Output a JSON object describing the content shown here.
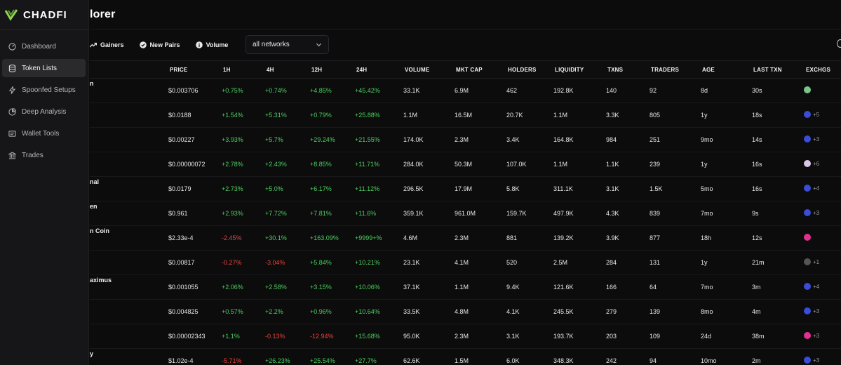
{
  "app": {
    "logo_text": "CHADFI",
    "page_title": "lorer",
    "brand_color": "#8fd14f"
  },
  "sidebar": {
    "items": [
      {
        "label": "Dashboard",
        "icon": "dashboard-icon",
        "active": false
      },
      {
        "label": "Token Lists",
        "icon": "database-icon",
        "active": true
      },
      {
        "label": "Spoonfed Setups",
        "icon": "bolt-icon",
        "active": false
      },
      {
        "label": "Deep Analysis",
        "icon": "pie-chart-icon",
        "active": false
      },
      {
        "label": "Wallet Tools",
        "icon": "wallet-icon",
        "active": false
      },
      {
        "label": "Trades",
        "icon": "bank-icon",
        "active": false
      }
    ]
  },
  "filters": {
    "gainers": "Gainers",
    "new_pairs": "New Pairs",
    "volume": "Volume",
    "network_select": "all networks"
  },
  "table": {
    "columns": [
      "PRICE",
      "1H",
      "4H",
      "12H",
      "24H",
      "VOLUME",
      "MKT CAP",
      "HOLDERS",
      "LIQUIDITY",
      "TXNS",
      "TRADERS",
      "AGE",
      "LAST TXN",
      "EXCHGS"
    ],
    "rows": [
      {
        "name": "n",
        "price": "$0.003706",
        "h1": "+0.75%",
        "h4": "+0.74%",
        "h12": "+4.85%",
        "h24": "+45.42%",
        "volume": "33.1K",
        "mktcap": "6.9M",
        "holders": "462",
        "liquidity": "192.8K",
        "txns": "140",
        "traders": "92",
        "age": "8d",
        "last": "30s",
        "exch_color": "#7cc48a",
        "exch_count": ""
      },
      {
        "name": "",
        "price": "$0.0188",
        "h1": "+1.54%",
        "h4": "+5.31%",
        "h12": "+0.79%",
        "h24": "+25.88%",
        "volume": "1.1M",
        "mktcap": "16.5M",
        "holders": "20.7K",
        "liquidity": "1.1M",
        "txns": "3.3K",
        "traders": "805",
        "age": "1y",
        "last": "18s",
        "exch_color": "#3a4cd8",
        "exch_count": "+5"
      },
      {
        "name": "",
        "price": "$0.00227",
        "h1": "+3.93%",
        "h4": "+5.7%",
        "h12": "+29.24%",
        "h24": "+21.55%",
        "volume": "174.0K",
        "mktcap": "2.3M",
        "holders": "3.4K",
        "liquidity": "164.8K",
        "txns": "984",
        "traders": "251",
        "age": "9mo",
        "last": "14s",
        "exch_color": "#3a4cd8",
        "exch_count": "+3"
      },
      {
        "name": "",
        "price": "$0.00000072",
        "h1": "+2.78%",
        "h4": "+2.43%",
        "h12": "+8.85%",
        "h24": "+11.71%",
        "volume": "284.0K",
        "mktcap": "50.3M",
        "holders": "107.0K",
        "liquidity": "1.1M",
        "txns": "1.1K",
        "traders": "239",
        "age": "1y",
        "last": "16s",
        "exch_color": "#d9c7e8",
        "exch_count": "+6"
      },
      {
        "name": "nal",
        "price": "$0.0179",
        "h1": "+2.73%",
        "h4": "+5.0%",
        "h12": "+6.17%",
        "h24": "+11.12%",
        "volume": "296.5K",
        "mktcap": "17.9M",
        "holders": "5.8K",
        "liquidity": "311.1K",
        "txns": "3.1K",
        "traders": "1.5K",
        "age": "5mo",
        "last": "16s",
        "exch_color": "#3a4cd8",
        "exch_count": "+4"
      },
      {
        "name": "en",
        "price": "$0.961",
        "h1": "+2.93%",
        "h4": "+7.72%",
        "h12": "+7.81%",
        "h24": "+11.6%",
        "volume": "359.1K",
        "mktcap": "961.0M",
        "holders": "159.7K",
        "liquidity": "497.9K",
        "txns": "4.3K",
        "traders": "839",
        "age": "7mo",
        "last": "9s",
        "exch_color": "#3a4cd8",
        "exch_count": "+3"
      },
      {
        "name": "n Coin",
        "price": "$2.33e-4",
        "h1": "-2.45%",
        "h4": "+30.1%",
        "h12": "+163.09%",
        "h24": "+9999+%",
        "volume": "4.6M",
        "mktcap": "2.3M",
        "holders": "881",
        "liquidity": "139.2K",
        "txns": "3.9K",
        "traders": "877",
        "age": "18h",
        "last": "12s",
        "exch_color": "#e0328c",
        "exch_count": ""
      },
      {
        "name": "",
        "price": "$0.00817",
        "h1": "-0.27%",
        "h4": "-3.04%",
        "h12": "+5.84%",
        "h24": "+10.21%",
        "volume": "23.1K",
        "mktcap": "4.1M",
        "holders": "520",
        "liquidity": "2.5M",
        "txns": "284",
        "traders": "131",
        "age": "1y",
        "last": "21m",
        "exch_color": "#555555",
        "exch_count": "+1"
      },
      {
        "name": "aximus",
        "price": "$0.001055",
        "h1": "+2.06%",
        "h4": "+2.58%",
        "h12": "+3.15%",
        "h24": "+10.06%",
        "volume": "37.1K",
        "mktcap": "1.1M",
        "holders": "9.4K",
        "liquidity": "121.6K",
        "txns": "166",
        "traders": "64",
        "age": "7mo",
        "last": "3m",
        "exch_color": "#3a4cd8",
        "exch_count": "+4"
      },
      {
        "name": "",
        "price": "$0.004825",
        "h1": "+0.57%",
        "h4": "+2.2%",
        "h12": "+0.96%",
        "h24": "+10.64%",
        "volume": "33.5K",
        "mktcap": "4.8M",
        "holders": "4.1K",
        "liquidity": "245.5K",
        "txns": "279",
        "traders": "139",
        "age": "8mo",
        "last": "4m",
        "exch_color": "#3a4cd8",
        "exch_count": "+3"
      },
      {
        "name": "",
        "price": "$0.00002343",
        "h1": "+1.1%",
        "h4": "-0.13%",
        "h12": "-12.94%",
        "h24": "+15.68%",
        "volume": "95.0K",
        "mktcap": "2.3M",
        "holders": "3.1K",
        "liquidity": "193.7K",
        "txns": "203",
        "traders": "109",
        "age": "24d",
        "last": "38m",
        "exch_color": "#e0328c",
        "exch_count": "+3"
      },
      {
        "name": "y",
        "price": "$1.02e-4",
        "h1": "-5.71%",
        "h4": "+26.23%",
        "h12": "+25.54%",
        "h24": "+27.7%",
        "volume": "62.6K",
        "mktcap": "1.5M",
        "holders": "6.0K",
        "liquidity": "348.3K",
        "txns": "242",
        "traders": "94",
        "age": "10mo",
        "last": "2m",
        "exch_color": "#3a4cd8",
        "exch_count": "+3"
      }
    ]
  }
}
